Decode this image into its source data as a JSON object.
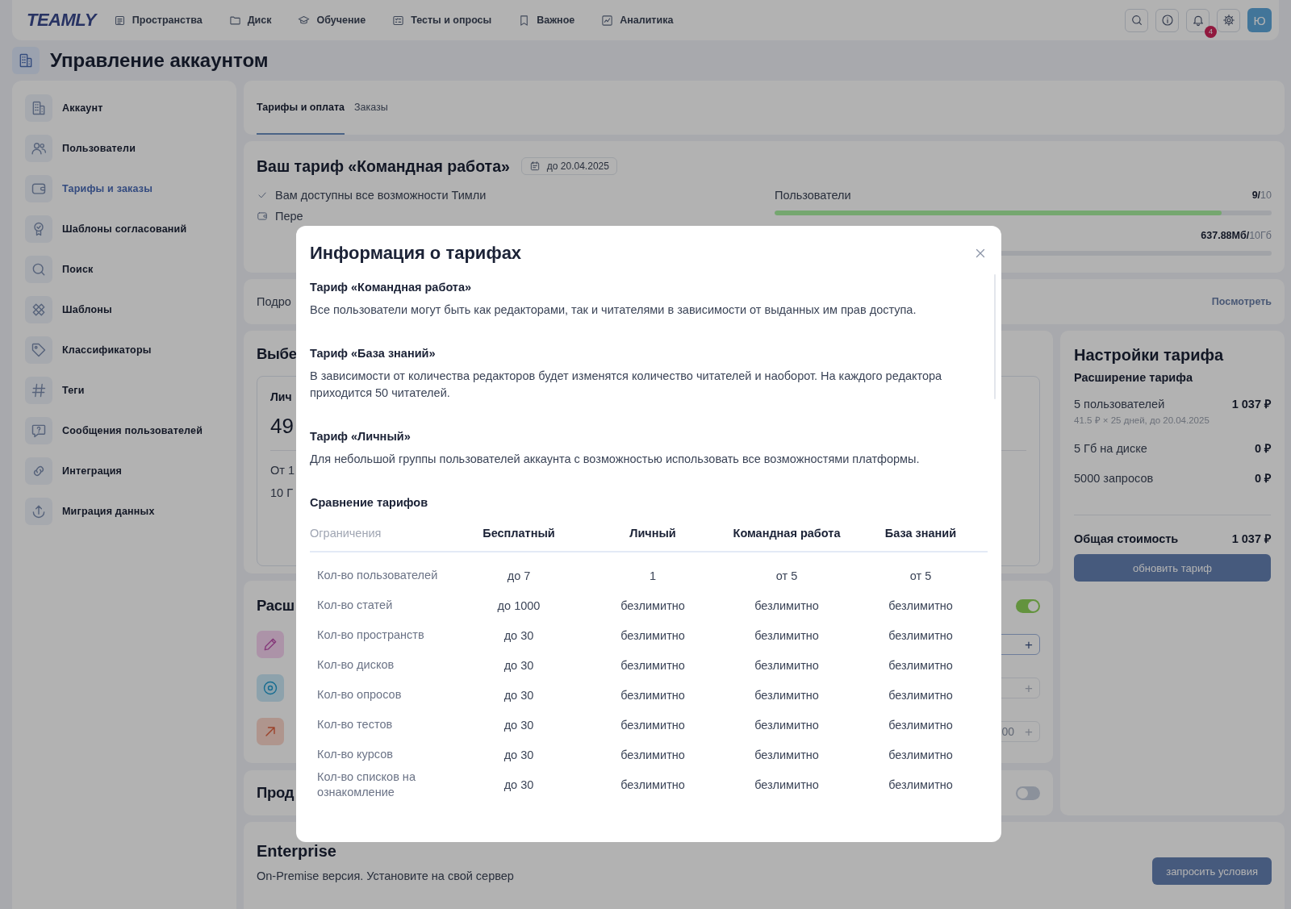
{
  "topbar": {
    "logo": "TEAMLY",
    "nav": [
      {
        "kind": "list",
        "label": "Пространства"
      },
      {
        "kind": "folder",
        "label": "Диск"
      },
      {
        "kind": "cap",
        "label": "Обучение"
      },
      {
        "kind": "checklist",
        "label": "Тесты и опросы"
      },
      {
        "kind": "bookmark",
        "label": "Важное"
      },
      {
        "kind": "chart",
        "label": "Аналитика"
      }
    ],
    "actions": [
      {
        "kind": "search"
      },
      {
        "kind": "info"
      },
      {
        "kind": "bell",
        "badge": "4"
      },
      {
        "kind": "settings"
      }
    ],
    "avatar": "Ю"
  },
  "page_title": "Управление аккаунтом",
  "sidebar": {
    "items": [
      {
        "kind": "building",
        "label": "Аккаунт",
        "selected": false
      },
      {
        "kind": "users",
        "label": "Пользователи",
        "selected": false
      },
      {
        "kind": "wallet",
        "label": "Тарифы и заказы",
        "selected": true
      },
      {
        "kind": "badge",
        "label": "Шаблоны согласований",
        "selected": false
      },
      {
        "kind": "search",
        "label": "Поиск",
        "selected": false
      },
      {
        "kind": "tools",
        "label": "Шаблоны",
        "selected": false
      },
      {
        "kind": "tag",
        "label": "Классификаторы",
        "selected": false
      },
      {
        "kind": "hash",
        "label": "Теги",
        "selected": false
      },
      {
        "kind": "message",
        "label": "Сообщения пользователей",
        "selected": false
      },
      {
        "kind": "link",
        "label": "Интеграция",
        "selected": false
      },
      {
        "kind": "upload",
        "label": "Миграция данных",
        "selected": false
      }
    ]
  },
  "tabs": [
    {
      "label": "Тарифы и оплата",
      "selected": true
    },
    {
      "label": "Заказы",
      "selected": false
    }
  ],
  "tariff": {
    "title": "Ваш тариф «Командная работа»",
    "date": "до 20.04.2025",
    "features": [
      {
        "kind": "check",
        "text": "Вам доступны все возможности Тимли"
      },
      {
        "kind": "wallet",
        "text": "Пере"
      }
    ],
    "meters": [
      {
        "label": "Пользователи",
        "used": "9/",
        "limit": "10",
        "level": 0.9
      },
      {
        "used": "637.88Мб/",
        "limit": "10Гб"
      }
    ]
  },
  "details": {
    "text": "Подро",
    "link": "Посмотреть"
  },
  "choose": {
    "title": "Выбе",
    "plan": {
      "name": "Лич",
      "price": "49",
      "lines": [
        "От 1",
        "10 Г"
      ]
    }
  },
  "extension": {
    "title": "Расш",
    "on": true,
    "rows": [
      {
        "kind": "pencil",
        "plus": "+",
        "disabled": false
      },
      {
        "kind": "disc",
        "plus": "+",
        "disabled": true
      },
      {
        "kind": "arrow",
        "value": "00",
        "plus": "+",
        "disabled": true
      }
    ]
  },
  "product": {
    "title": "Прод",
    "on": false
  },
  "enterprise": {
    "title": "Enterprise",
    "text": "On-Premise версия. Установите на свой сервер",
    "button": "запросить условия"
  },
  "settings": {
    "title": "Настройки тарифа",
    "subtitle": "Расширение тарифа",
    "items": [
      {
        "label": "5 пользователей",
        "price": "1 037 ₽",
        "note": "41.5 ₽ × 25 дней, до 20.04.2025"
      },
      {
        "label": "5 Гб на диске",
        "price": "0 ₽"
      },
      {
        "label": "5000 запросов",
        "price": "0 ₽"
      }
    ],
    "total_label": "Общая стоимость",
    "total": "1 037 ₽",
    "button": "обновить тариф"
  },
  "modal": {
    "title": "Информация о тарифах",
    "sections": [
      {
        "heading": "Тариф «Командная работа»",
        "text": "Все пользователи могут быть как редакторами, так и читателями в зависимости от выданных им прав доступа."
      },
      {
        "heading": "Тариф «База знаний»",
        "text": "В зависимости от количества редакторов будет изменятся количество читателей и наоборот. На каждого редактора приходится 50 читателей."
      },
      {
        "heading": "Тариф «Личный»",
        "text": "Для небольшой группы пользователей аккаунта с возможностью использовать все возможностями платформы."
      }
    ],
    "comparison": {
      "title": "Сравнение тарифов",
      "columns": [
        "Ограничения",
        "Бесплатный",
        "Личный",
        "Командная работа",
        "База знаний"
      ],
      "rows": [
        {
          "label": "Кол-во пользователей",
          "values": [
            "до 7",
            "1",
            "от 5",
            "от 5"
          ]
        },
        {
          "label": "Кол-во статей",
          "values": [
            "до 1000",
            "безлимитно",
            "безлимитно",
            "безлимитно"
          ]
        },
        {
          "label": "Кол-во пространств",
          "values": [
            "до 30",
            "безлимитно",
            "безлимитно",
            "безлимитно"
          ]
        },
        {
          "label": "Кол-во дисков",
          "values": [
            "до 30",
            "безлимитно",
            "безлимитно",
            "безлимитно"
          ]
        },
        {
          "label": "Кол-во опросов",
          "values": [
            "до 30",
            "безлимитно",
            "безлимитно",
            "безлимитно"
          ]
        },
        {
          "label": "Кол-во тестов",
          "values": [
            "до 30",
            "безлимитно",
            "безлимитно",
            "безлимитно"
          ]
        },
        {
          "label": "Кол-во курсов",
          "values": [
            "до 30",
            "безлимитно",
            "безлимитно",
            "безлимитно"
          ]
        },
        {
          "label": "Кол-во списков на ознакомление",
          "values": [
            "до 30",
            "безлимитно",
            "безлимитно",
            "безлимитно"
          ]
        }
      ]
    }
  }
}
